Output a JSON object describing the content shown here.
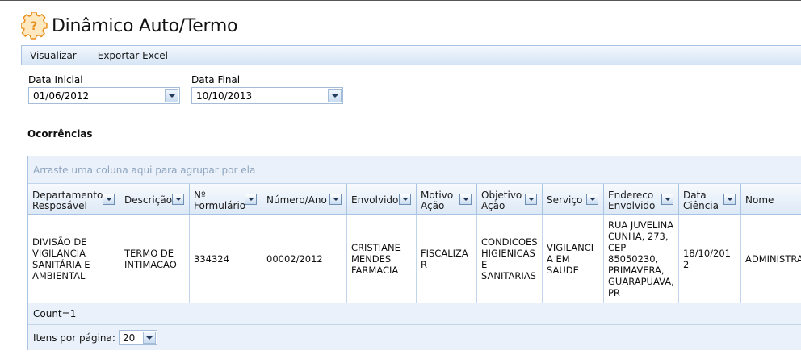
{
  "header": {
    "title": "Dinâmico Auto/Termo",
    "icon": "gear-question-icon"
  },
  "menu": {
    "items": [
      "Visualizar",
      "Exportar Excel"
    ]
  },
  "filters": {
    "start": {
      "label": "Data Inicial",
      "value": "01/06/2012"
    },
    "end": {
      "label": "Data Final",
      "value": "10/10/2013"
    }
  },
  "section": {
    "title": "Ocorrências"
  },
  "grid": {
    "group_hint": "Arraste uma coluna aqui para agrupar por ela",
    "columns": [
      "Departamento Resposável",
      "Descrição",
      "Nº Formulário",
      "Número/Ano",
      "Envolvido",
      "Motivo Ação",
      "Objetivo Ação",
      "Serviço",
      "Endereco Envolvido",
      "Data Ciência",
      "Nome"
    ],
    "rows": [
      [
        "DIVISÃO DE VIGILANCIA SANITÁRIA E AMBIENTAL",
        "TERMO DE INTIMACAO",
        "334324",
        "00002/2012",
        "CRISTIANE MENDES FARMACIA",
        "FISCALIZAR",
        "CONDICOES HIGIENICAS E SANITARIAS",
        "VIGILANCIA EM SAUDE",
        "RUA JUVELINA CUNHA, 273, CEP 85050230, PRIMAVERA, GUARAPUAVA, PR",
        "18/10/2012",
        "ADMINISTRADOR SISTEMA"
      ]
    ],
    "count_text": "Count=1",
    "pager": {
      "label": "Itens por página:",
      "page_size": "20"
    }
  },
  "colors": {
    "accent": "#a9c4e3",
    "panel": "#eaf1fa",
    "icon": "#f0a030"
  }
}
